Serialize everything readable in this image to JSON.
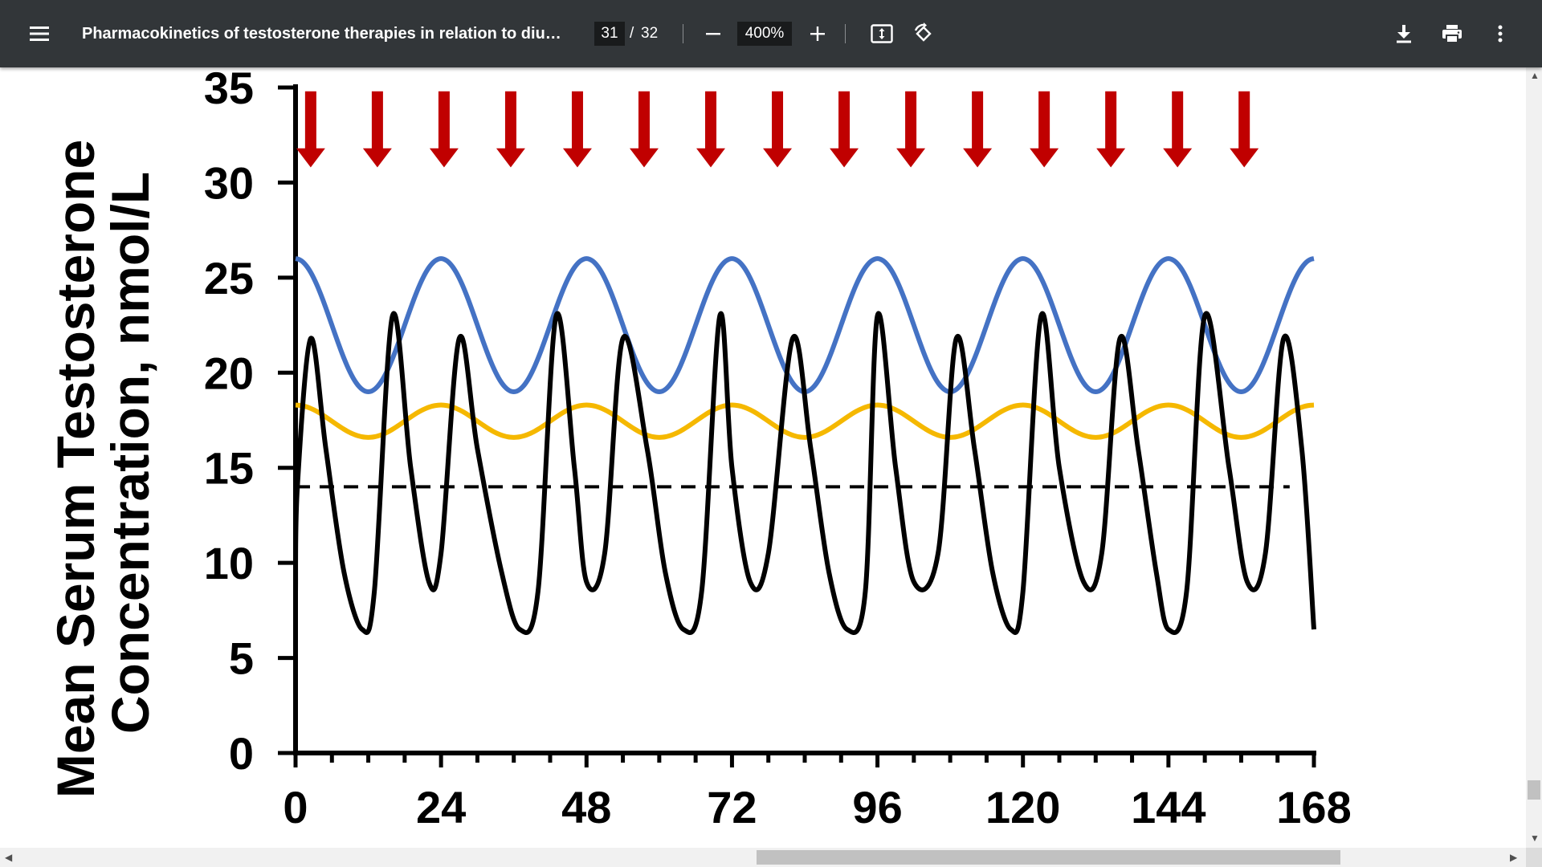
{
  "toolbar": {
    "title": "Pharmacokinetics of testosterone therapies in relation to diurn...",
    "page_current": "31",
    "page_separator": "/",
    "page_total": "32",
    "zoom": "400%",
    "icons": [
      "menu-icon",
      "zoom-out-icon",
      "zoom-in-icon",
      "fit-page-icon",
      "rotate-icon",
      "download-icon",
      "print-icon",
      "more-vert-icon"
    ],
    "background": "#323639"
  },
  "chart_data": {
    "type": "line",
    "title": "",
    "ylabel_line1": "Mean Serum Testosterone",
    "ylabel_line2": "Concentration, nmol/L",
    "xlabel": "",
    "xlim": [
      0,
      168
    ],
    "ylim": [
      0,
      35
    ],
    "x_ticks": [
      "0",
      "24",
      "48",
      "72",
      "96",
      "120",
      "144",
      "168"
    ],
    "y_ticks": [
      "0",
      "5",
      "10",
      "15",
      "20",
      "25",
      "30",
      "35"
    ],
    "grid": false,
    "legend": "none",
    "dose_arrow_times": [
      2.5,
      13.5,
      24.5,
      35.5,
      46.5,
      57.5,
      68.5,
      79.5,
      90.5,
      101.5,
      112.5,
      123.5,
      134.5,
      145.5,
      156.5
    ],
    "series": [
      {
        "color": "#4472c4",
        "style": "solid",
        "period": 24,
        "x": [
          0,
          6,
          12,
          18,
          24,
          30,
          36,
          42,
          48,
          54,
          60,
          66,
          72,
          78,
          84,
          90,
          96,
          102,
          108,
          114,
          120,
          126,
          132,
          138,
          144,
          150,
          156,
          162,
          168
        ],
        "y": [
          26,
          22.5,
          19,
          22.5,
          26,
          22.5,
          19,
          22.5,
          26,
          22.5,
          19,
          22.5,
          26,
          22.5,
          19,
          22.5,
          26,
          22.5,
          19,
          22.5,
          26,
          22.5,
          19,
          22.5,
          26,
          22.5,
          19,
          22.5,
          26
        ]
      },
      {
        "color": "#f5b800",
        "style": "solid",
        "period": 24,
        "x": [
          0,
          6,
          12,
          18,
          24,
          30,
          36,
          42,
          48,
          54,
          60,
          66,
          72,
          78,
          84,
          90,
          96,
          102,
          108,
          114,
          120,
          126,
          132,
          138,
          144,
          150,
          156,
          162,
          168
        ],
        "y": [
          18.3,
          17.45,
          16.6,
          17.45,
          18.3,
          17.45,
          16.6,
          17.45,
          18.3,
          17.45,
          16.6,
          17.45,
          18.3,
          17.45,
          16.6,
          17.45,
          18.3,
          17.45,
          16.6,
          17.45,
          18.3,
          17.45,
          16.6,
          17.45,
          18.3,
          17.45,
          16.6,
          17.45,
          18.3
        ]
      },
      {
        "color": "#000000",
        "style": "solid",
        "x": [
          0,
          0.3,
          2.5,
          5,
          8,
          11,
          13,
          16,
          19,
          22,
          24,
          27,
          30,
          34,
          37,
          40,
          43,
          46,
          48,
          51,
          54,
          58,
          61,
          64,
          67,
          70,
          72,
          75,
          78,
          82,
          85,
          88,
          91,
          94,
          96,
          99,
          102,
          106,
          109,
          112,
          115,
          118,
          120,
          123,
          126,
          130,
          133,
          136,
          139,
          142,
          144,
          147,
          150,
          154,
          157,
          160,
          163,
          166,
          168
        ],
        "y": [
          8.5,
          14,
          21.8,
          16,
          9.5,
          6.5,
          8.5,
          23,
          15,
          9,
          10.5,
          21.8,
          16,
          9.5,
          6.5,
          8.5,
          23,
          15,
          9,
          10.5,
          21.8,
          16,
          9.5,
          6.5,
          8.5,
          23,
          15,
          9,
          10.5,
          21.8,
          16,
          9.5,
          6.5,
          8.5,
          23,
          15,
          9,
          10.5,
          21.8,
          16,
          9.5,
          6.5,
          8.5,
          23,
          15,
          9,
          10.5,
          21.8,
          16,
          9.5,
          6.5,
          8.5,
          23,
          15,
          9,
          10.5,
          21.8,
          16,
          6.5
        ]
      },
      {
        "color": "#000000",
        "style": "dashed",
        "x": [
          0,
          164
        ],
        "y": [
          14,
          14
        ]
      }
    ],
    "arrow_color": "#c00000"
  }
}
